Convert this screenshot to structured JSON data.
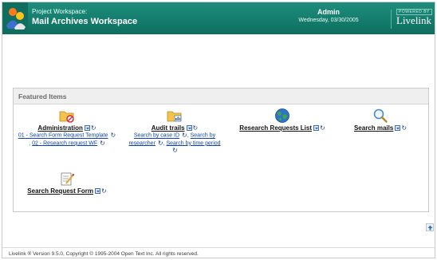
{
  "header": {
    "workspace_label": "Project Workspace:",
    "workspace_name": "Mail Archives Workspace",
    "user_name": "Admin",
    "date": "Wednesday, 03/30/2005",
    "powered_by": "POWERED BY",
    "brand": "Livelink",
    "accent_color": "#137a6a"
  },
  "featured": {
    "title": "Featured Items",
    "items": [
      {
        "title": "Administration",
        "icon": "folder-no-entry-icon",
        "links": [
          "01 - Search Form Request Template",
          "02 - Research request WF"
        ],
        "link_sep": ","
      },
      {
        "title": "Audit trails",
        "icon": "folder-chart-icon",
        "links": [
          "Search by case ID",
          "Search by researcher",
          "Search by time period"
        ],
        "link_sep": ","
      },
      {
        "title": "Research Requests List",
        "icon": "globe-icon",
        "links": []
      },
      {
        "title": "Search mails",
        "icon": "magnifier-icon",
        "links": []
      },
      {
        "title": "Search Request Form",
        "icon": "edit-form-icon",
        "links": []
      }
    ]
  },
  "footer": {
    "copyright": "Livelink ® Version 9.5.0, Copyright © 1995-2004 Open Text Inc. All rights reserved."
  }
}
